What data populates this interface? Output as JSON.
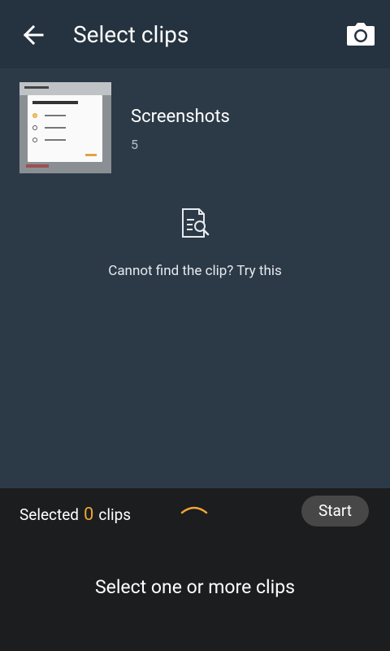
{
  "header": {
    "title": "Select clips",
    "back_icon": "arrow-left-icon",
    "camera_icon": "camera-icon"
  },
  "folder": {
    "name": "Screenshots",
    "count": "5"
  },
  "help": {
    "icon": "document-search-icon",
    "text": "Cannot find the clip? Try this"
  },
  "bottom_bar": {
    "selected_prefix": "Selected",
    "selected_count": "0",
    "selected_suffix": "clips",
    "expand_icon": "chevron-up-icon",
    "start_label": "Start",
    "hint": "Select one or more clips"
  },
  "colors": {
    "content_bg": "#2c3a48",
    "appbar_bg": "#25323f",
    "bottom_bg": "#1b1d1e",
    "accent": "#f1a436",
    "start_button_bg": "#474747"
  }
}
